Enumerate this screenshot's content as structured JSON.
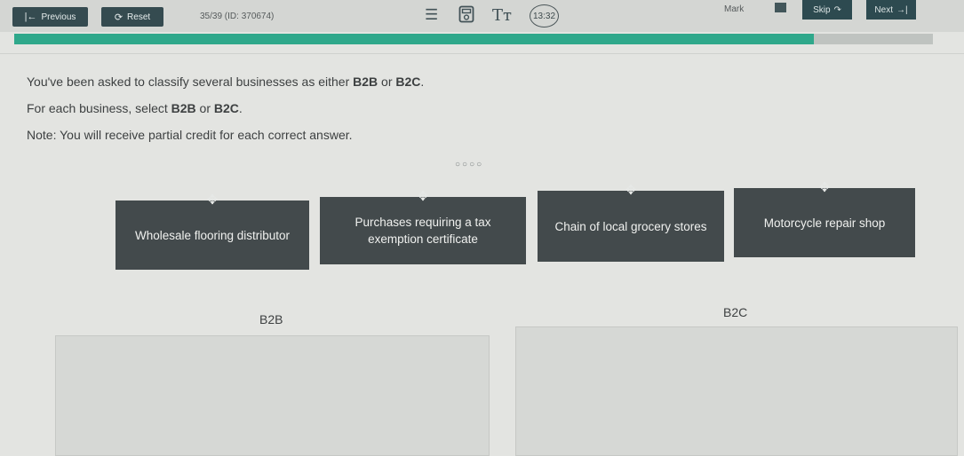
{
  "toolbar": {
    "previous_label": "Previous",
    "reset_label": "Reset",
    "question_id": "35/39 (ID: 370674)",
    "timer": "13:32",
    "mark_label": "Mark",
    "skip_label": "Skip",
    "next_label": "Next"
  },
  "progress": {
    "fraction": 0.87
  },
  "instructions": {
    "line1_pre": "You've been asked to classify several businesses as either ",
    "line1_b2b": "B2B",
    "line1_or": " or ",
    "line1_b2c": "B2C",
    "line1_end": ".",
    "line2_pre": "For each business, select ",
    "line2_b2b": "B2B",
    "line2_or": " or ",
    "line2_b2c": "B2C",
    "line2_end": ".",
    "line3": "Note: You will receive partial credit for each correct answer."
  },
  "pager_dots": "○○○○",
  "cards": [
    {
      "label": "Wholesale flooring distributor"
    },
    {
      "label": "Purchases requiring a tax exemption certificate"
    },
    {
      "label": "Chain of local grocery stores"
    },
    {
      "label": "Motorcycle repair shop"
    }
  ],
  "categories": {
    "b2b": "B2B",
    "b2c": "B2C"
  },
  "icons": {
    "previous": "previous-icon",
    "reset": "reset-icon",
    "list": "list-icon",
    "calculator": "calculator-icon",
    "text_size": "text-size-icon",
    "move": "move-icon"
  },
  "colors": {
    "progress": "#2fa88b",
    "card": "#434a4c",
    "button": "#354b50"
  }
}
